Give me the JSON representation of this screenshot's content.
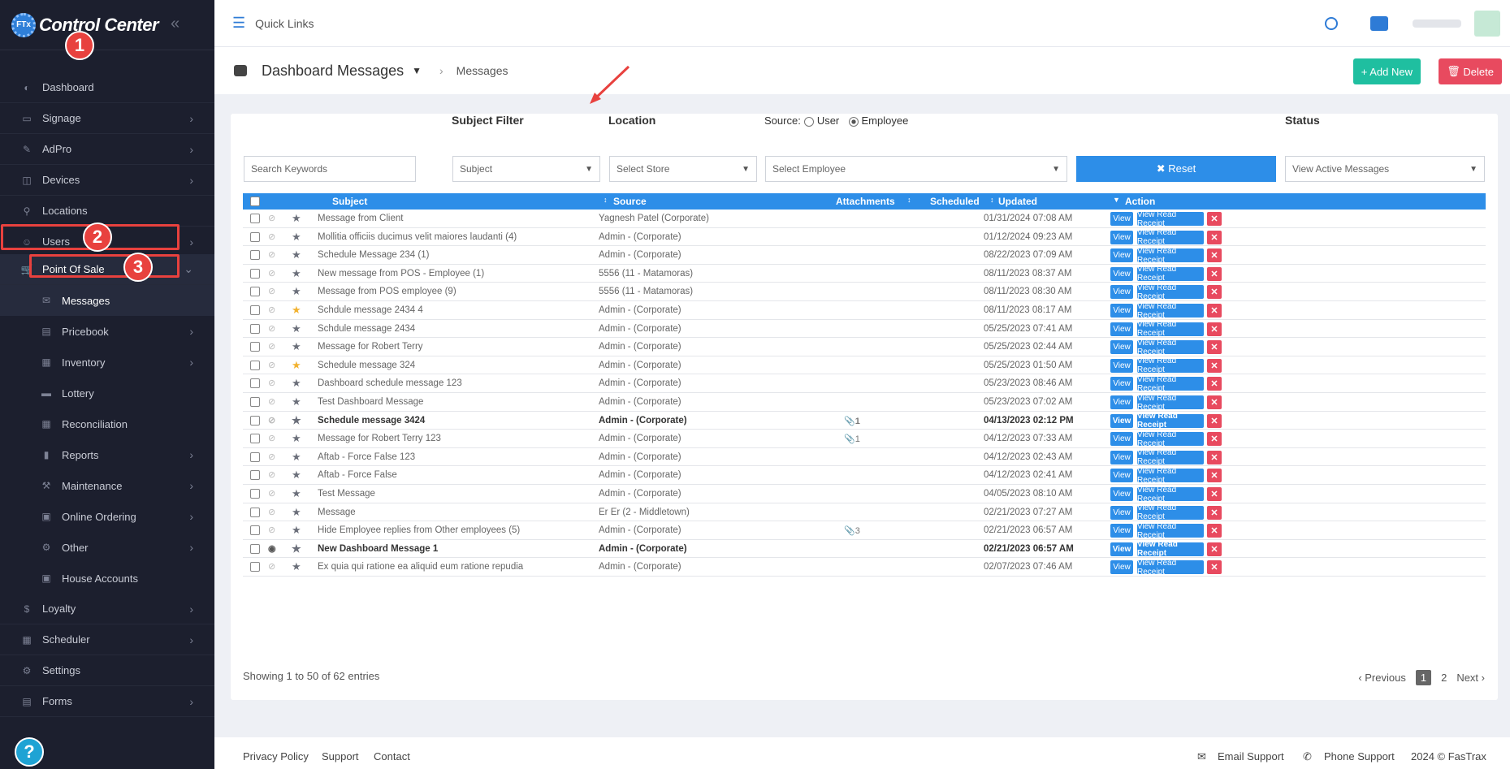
{
  "sidebar": {
    "brand": "Control Center",
    "brand_badge": "FTx",
    "items": [
      {
        "label": "Dashboard",
        "icon": "palette-icon",
        "chev": false
      },
      {
        "label": "Signage",
        "icon": "monitor-icon",
        "chev": true
      },
      {
        "label": "AdPro",
        "icon": "brush-icon",
        "chev": true
      },
      {
        "label": "Devices",
        "icon": "router-icon",
        "chev": true
      },
      {
        "label": "Locations",
        "icon": "map-pin-icon",
        "chev": false
      },
      {
        "label": "Users",
        "icon": "users-icon",
        "chev": true
      },
      {
        "label": "Point Of Sale",
        "icon": "cart-icon",
        "chev": true
      },
      {
        "label": "Messages",
        "icon": "message-icon",
        "chev": false,
        "sub": true
      },
      {
        "label": "Pricebook",
        "icon": "book-icon",
        "chev": true,
        "sub": true
      },
      {
        "label": "Inventory",
        "icon": "boxes-icon",
        "chev": true,
        "sub": true
      },
      {
        "label": "Lottery",
        "icon": "ticket-icon",
        "chev": false,
        "sub": true
      },
      {
        "label": "Reconciliation",
        "icon": "grid-icon",
        "chev": false,
        "sub": true
      },
      {
        "label": "Reports",
        "icon": "bar-chart-icon",
        "chev": true,
        "sub": true
      },
      {
        "label": "Maintenance",
        "icon": "wrench-icon",
        "chev": true,
        "sub": true
      },
      {
        "label": "Online Ordering",
        "icon": "bag-icon",
        "chev": true,
        "sub": true
      },
      {
        "label": "Other",
        "icon": "gears-icon",
        "chev": true,
        "sub": true
      },
      {
        "label": "House Accounts",
        "icon": "bag-icon",
        "chev": false,
        "sub": true
      },
      {
        "label": "Loyalty",
        "icon": "dollar-icon",
        "chev": true
      },
      {
        "label": "Scheduler",
        "icon": "calendar-icon",
        "chev": true
      },
      {
        "label": "Settings",
        "icon": "gear-icon",
        "chev": false
      },
      {
        "label": "Forms",
        "icon": "form-icon",
        "chev": true
      }
    ],
    "annotations": [
      "1",
      "2",
      "3"
    ],
    "help": "?"
  },
  "topbar": {
    "quick_links": "Quick Links"
  },
  "header": {
    "title": "Dashboard Messages",
    "crumb": "Messages",
    "add_label": "+ Add New",
    "delete_label": "Delete"
  },
  "filters": {
    "search_placeholder": "Search Keywords",
    "subject_label": "Subject Filter",
    "subject_value": "Subject",
    "location_label": "Location",
    "location_value": "Select Store",
    "source_label": "Source:",
    "source_user": "User",
    "source_employee": "Employee",
    "employee_value": "Select Employee",
    "reset_label": "✖ Reset",
    "status_label": "Status",
    "status_value": "View Active Messages"
  },
  "table": {
    "columns": {
      "subject": "Subject",
      "source": "Source",
      "attachments": "Attachments",
      "scheduled": "Scheduled",
      "updated": "Updated",
      "action": "Action"
    },
    "view": "View",
    "receipt": "View Read Receipt",
    "rows": [
      {
        "subject": "Message from Client",
        "source": "Yagnesh Patel (Corporate)",
        "att": "",
        "updated": "01/31/2024 07:08 AM",
        "star": "gray",
        "bold": false
      },
      {
        "subject": "Mollitia officiis ducimus velit maiores laudanti (4)",
        "source": "Admin - (Corporate)",
        "att": "",
        "updated": "01/12/2024 09:23 AM",
        "star": "gray",
        "bold": false
      },
      {
        "subject": "Schedule Message 234 (1)",
        "source": "Admin - (Corporate)",
        "att": "",
        "updated": "08/22/2023 07:09 AM",
        "star": "gray",
        "bold": false
      },
      {
        "subject": "New message from POS - Employee (1)",
        "source": "5556  (11 - Matamoras)",
        "att": "",
        "updated": "08/11/2023 08:37 AM",
        "star": "gray",
        "bold": false
      },
      {
        "subject": "Message from POS employee (9)",
        "source": "5556  (11 - Matamoras)",
        "att": "",
        "updated": "08/11/2023 08:30 AM",
        "star": "gray",
        "bold": false
      },
      {
        "subject": "Schdule message 2434 4",
        "source": "Admin - (Corporate)",
        "att": "",
        "updated": "08/11/2023 08:17 AM",
        "star": "gold",
        "bold": false
      },
      {
        "subject": "Schdule message 2434",
        "source": "Admin - (Corporate)",
        "att": "",
        "updated": "05/25/2023 07:41 AM",
        "star": "gray",
        "bold": false
      },
      {
        "subject": "Message for Robert Terry",
        "source": "Admin - (Corporate)",
        "att": "",
        "updated": "05/25/2023 02:44 AM",
        "star": "gray",
        "bold": false
      },
      {
        "subject": "Schedule message 324",
        "source": "Admin - (Corporate)",
        "att": "",
        "updated": "05/25/2023 01:50 AM",
        "star": "gold",
        "bold": false
      },
      {
        "subject": "Dashboard schedule message 123",
        "source": "Admin - (Corporate)",
        "att": "",
        "updated": "05/23/2023 08:46 AM",
        "star": "gray",
        "bold": false
      },
      {
        "subject": "Test Dashboard Message",
        "source": "Admin - (Corporate)",
        "att": "",
        "updated": "05/23/2023 07:02 AM",
        "star": "gray",
        "bold": false
      },
      {
        "subject": "Schedule message 3424",
        "source": "Admin - (Corporate)",
        "att": "1",
        "updated": "04/13/2023 02:12 PM",
        "star": "gray",
        "bold": true
      },
      {
        "subject": "Message for Robert Terry  123",
        "source": "Admin - (Corporate)",
        "att": "1",
        "updated": "04/12/2023 07:33 AM",
        "star": "gray",
        "bold": false
      },
      {
        "subject": "Aftab - Force False  123",
        "source": "Admin - (Corporate)",
        "att": "",
        "updated": "04/12/2023 02:43 AM",
        "star": "gray",
        "bold": false
      },
      {
        "subject": "Aftab - Force False",
        "source": "Admin - (Corporate)",
        "att": "",
        "updated": "04/12/2023 02:41 AM",
        "star": "gray",
        "bold": false
      },
      {
        "subject": "Test Message",
        "source": "Admin - (Corporate)",
        "att": "",
        "updated": "04/05/2023 08:10 AM",
        "star": "gray",
        "bold": false
      },
      {
        "subject": "Message",
        "source": "Er Er (2 - Middletown)",
        "att": "",
        "updated": "02/21/2023 07:27 AM",
        "star": "gray",
        "bold": false
      },
      {
        "subject": "Hide Employee replies from Other employees (5)",
        "source": "Admin - (Corporate)",
        "att": "3",
        "updated": "02/21/2023 06:57 AM",
        "star": "gray",
        "bold": false
      },
      {
        "subject": "New Dashboard Message 1",
        "source": "Admin - (Corporate)",
        "att": "",
        "updated": "02/21/2023 06:57 AM",
        "star": "gray",
        "bold": true,
        "seen": true
      },
      {
        "subject": "Ex quia qui ratione ea aliquid eum ratione repudia",
        "source": "Admin - (Corporate)",
        "att": "",
        "updated": "02/07/2023 07:46 AM",
        "star": "gray",
        "bold": false
      }
    ],
    "showing": "Showing 1 to 50 of 62 entries",
    "pager": {
      "prev": "Previous",
      "p1": "1",
      "p2": "2",
      "next": "Next"
    }
  },
  "footer": {
    "privacy": "Privacy Policy",
    "support": "Support",
    "contact": "Contact",
    "email": "Email Support",
    "phone": "Phone Support",
    "copy": "2024 © FasTrax"
  },
  "colors": {
    "primary": "#2d8ee8",
    "sidebar": "#1c1f2e",
    "danger": "#e84a5f",
    "success": "#1fbfa0",
    "annotation": "#e8413e"
  }
}
